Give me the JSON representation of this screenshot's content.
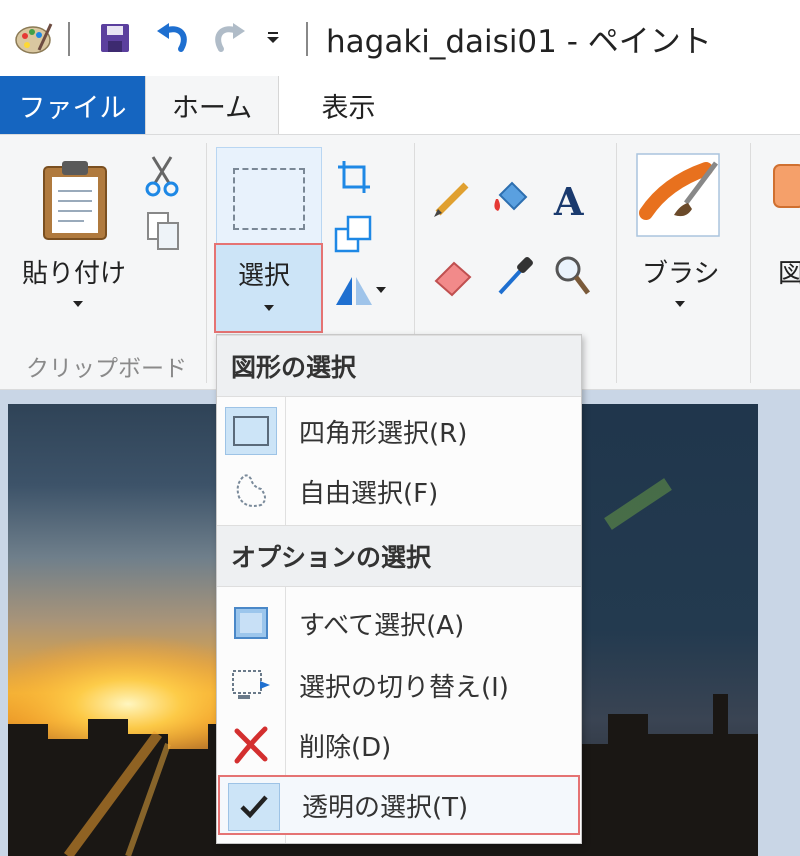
{
  "window": {
    "title": "hagaki_daisi01 - ペイント"
  },
  "tabs": [
    {
      "label": "ファイル"
    },
    {
      "label": "ホーム"
    },
    {
      "label": "表示"
    }
  ],
  "clipboard": {
    "paste_label": "貼り付け",
    "group_label": "クリップボード"
  },
  "image_group": {
    "select_label": "選択"
  },
  "brush": {
    "label": "ブラシ"
  },
  "shapes": {
    "label_partial": "図"
  },
  "select_menu": {
    "header1": "図形の選択",
    "header2": "オプションの選択",
    "items": [
      {
        "label": "四角形選択(R)",
        "icon": "rectangle-select-icon"
      },
      {
        "label": "自由選択(F)",
        "icon": "free-form-select-icon"
      },
      {
        "label": "すべて選択(A)",
        "icon": "select-all-icon"
      },
      {
        "label": "選択の切り替え(I)",
        "icon": "invert-selection-icon"
      },
      {
        "label": "削除(D)",
        "icon": "delete-icon"
      },
      {
        "label": "透明の選択(T)",
        "icon": "checkmark-icon",
        "checked": true
      }
    ]
  },
  "colors": {
    "file_tab": "#1565c0",
    "highlight_border": "#e57373",
    "select_bg": "#cce4f7"
  }
}
